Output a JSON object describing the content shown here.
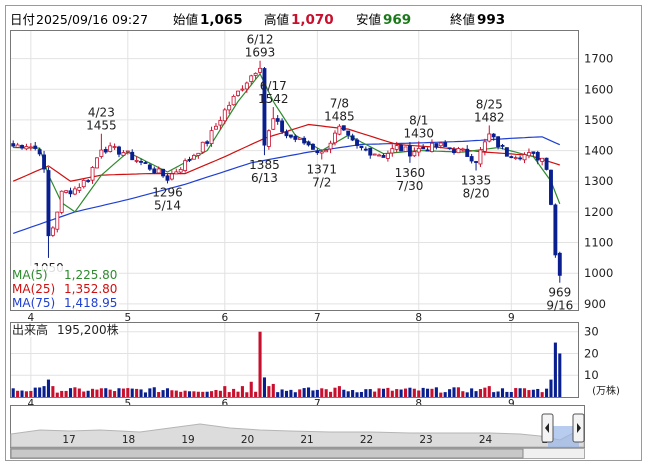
{
  "header": {
    "date_label": "日付",
    "datetime": "2025/09/16 09:27",
    "open_label": "始値",
    "open": "1,065",
    "high_label": "高値",
    "high": "1,070",
    "low_label": "安値",
    "low": "969",
    "close_label": "終値",
    "close": "993"
  },
  "colors": {
    "up": "#c8102e",
    "down": "#0a1f8f",
    "ma5": "#2e8b2e",
    "ma25": "#d01010",
    "ma75": "#1f3fd1",
    "high_value": "#c8102e",
    "low_value": "#1a7a1a"
  },
  "legend": {
    "ma5_label": "MA(5)",
    "ma5_value": "1,225.80",
    "ma25_label": "MA(25)",
    "ma25_value": "1,352.80",
    "ma75_label": "MA(75)",
    "ma75_value": "1,418.95"
  },
  "volume_header": {
    "label": "出来高",
    "value": "195,200株"
  },
  "volume_unit": "(万株)",
  "chart_data": [
    {
      "type": "candlestick",
      "title": "",
      "x_tick_labels": [
        "4",
        "5",
        "6",
        "7",
        "8",
        "9"
      ],
      "y_ticks": [
        900,
        1000,
        1100,
        1200,
        1300,
        1400,
        1500,
        1600,
        1700
      ],
      "ylim": [
        880,
        1790
      ],
      "grid": true,
      "x_start": "2025-03-26",
      "x_end": "2025-09-16",
      "x_tick_dates": [
        "2025-04-01",
        "2025-05-01",
        "2025-06-02",
        "2025-07-01",
        "2025-08-01",
        "2025-09-01"
      ],
      "anchors": [
        [
          "2025-03-26",
          1415
        ],
        [
          "2025-03-31",
          1420
        ],
        [
          "2025-04-03",
          1400
        ],
        [
          "2025-04-04",
          1330
        ],
        [
          "2025-04-07",
          1120
        ],
        [
          "2025-04-08",
          1150
        ],
        [
          "2025-04-10",
          1260
        ],
        [
          "2025-04-15",
          1275
        ],
        [
          "2025-04-18",
          1310
        ],
        [
          "2025-04-23",
          1410
        ],
        [
          "2025-04-30",
          1395
        ],
        [
          "2025-05-08",
          1345
        ],
        [
          "2025-05-14",
          1310
        ],
        [
          "2025-05-20",
          1360
        ],
        [
          "2025-05-27",
          1430
        ],
        [
          "2025-06-02",
          1530
        ],
        [
          "2025-06-06",
          1610
        ],
        [
          "2025-06-12",
          1680
        ],
        [
          "2025-06-13",
          1420
        ],
        [
          "2025-06-17",
          1500
        ],
        [
          "2025-06-20",
          1450
        ],
        [
          "2025-06-27",
          1420
        ],
        [
          "2025-07-02",
          1390
        ],
        [
          "2025-07-08",
          1470
        ],
        [
          "2025-07-14",
          1410
        ],
        [
          "2025-07-22",
          1385
        ],
        [
          "2025-07-25",
          1410
        ],
        [
          "2025-07-30",
          1395
        ],
        [
          "2025-08-01",
          1405
        ],
        [
          "2025-08-08",
          1415
        ],
        [
          "2025-08-15",
          1395
        ],
        [
          "2025-08-20",
          1370
        ],
        [
          "2025-08-25",
          1450
        ],
        [
          "2025-08-29",
          1390
        ],
        [
          "2025-09-05",
          1385
        ],
        [
          "2025-09-10",
          1375
        ],
        [
          "2025-09-11",
          1350
        ],
        [
          "2025-09-12",
          1230
        ],
        [
          "2025-09-15",
          1060
        ],
        [
          "2025-09-16",
          993
        ]
      ],
      "ma5": [
        [
          "2025-03-26",
          1410
        ],
        [
          "2025-04-03",
          1408
        ],
        [
          "2025-04-07",
          1320
        ],
        [
          "2025-04-10",
          1230
        ],
        [
          "2025-04-15",
          1200
        ],
        [
          "2025-04-23",
          1320
        ],
        [
          "2025-05-01",
          1395
        ],
        [
          "2025-05-14",
          1330
        ],
        [
          "2025-05-27",
          1400
        ],
        [
          "2025-06-05",
          1560
        ],
        [
          "2025-06-12",
          1650
        ],
        [
          "2025-06-17",
          1560
        ],
        [
          "2025-06-24",
          1450
        ],
        [
          "2025-07-02",
          1400
        ],
        [
          "2025-07-10",
          1450
        ],
        [
          "2025-07-22",
          1390
        ],
        [
          "2025-08-01",
          1400
        ],
        [
          "2025-08-15",
          1395
        ],
        [
          "2025-08-27",
          1410
        ],
        [
          "2025-09-08",
          1380
        ],
        [
          "2025-09-12",
          1300
        ],
        [
          "2025-09-16",
          1226
        ]
      ],
      "ma25": [
        [
          "2025-03-26",
          1300
        ],
        [
          "2025-04-07",
          1350
        ],
        [
          "2025-04-14",
          1300
        ],
        [
          "2025-04-23",
          1320
        ],
        [
          "2025-05-08",
          1325
        ],
        [
          "2025-05-20",
          1325
        ],
        [
          "2025-06-02",
          1380
        ],
        [
          "2025-06-13",
          1440
        ],
        [
          "2025-06-27",
          1485
        ],
        [
          "2025-07-10",
          1470
        ],
        [
          "2025-07-25",
          1420
        ],
        [
          "2025-08-08",
          1410
        ],
        [
          "2025-08-22",
          1395
        ],
        [
          "2025-09-05",
          1385
        ],
        [
          "2025-09-16",
          1353
        ]
      ],
      "ma75": [
        [
          "2025-03-26",
          1130
        ],
        [
          "2025-04-15",
          1200
        ],
        [
          "2025-05-01",
          1240
        ],
        [
          "2025-05-20",
          1290
        ],
        [
          "2025-06-10",
          1360
        ],
        [
          "2025-06-27",
          1395
        ],
        [
          "2025-07-15",
          1420
        ],
        [
          "2025-08-01",
          1425
        ],
        [
          "2025-08-15",
          1430
        ],
        [
          "2025-09-01",
          1440
        ],
        [
          "2025-09-10",
          1445
        ],
        [
          "2025-09-16",
          1419
        ]
      ],
      "annotations": [
        {
          "date": "2025-06-12",
          "price": 1693,
          "text_date": "6/12",
          "text_value": "1693",
          "pos": "above"
        },
        {
          "date": "2025-06-17",
          "price": 1542,
          "text_date": "6/17",
          "text_value": "1542",
          "pos": "above"
        },
        {
          "date": "2025-04-23",
          "price": 1455,
          "text_date": "4/23",
          "text_value": "1455",
          "pos": "above"
        },
        {
          "date": "2025-07-08",
          "price": 1485,
          "text_date": "7/8",
          "text_value": "1485",
          "pos": "above"
        },
        {
          "date": "2025-08-01",
          "price": 1430,
          "text_date": "8/1",
          "text_value": "1430",
          "pos": "above"
        },
        {
          "date": "2025-08-25",
          "price": 1482,
          "text_date": "8/25",
          "text_value": "1482",
          "pos": "above"
        },
        {
          "date": "2025-06-13",
          "price": 1385,
          "text_date": "6/13",
          "text_value": "1385",
          "pos": "below"
        },
        {
          "date": "2025-07-02",
          "price": 1371,
          "text_date": "7/2",
          "text_value": "1371",
          "pos": "below"
        },
        {
          "date": "2025-07-30",
          "price": 1360,
          "text_date": "7/30",
          "text_value": "1360",
          "pos": "below"
        },
        {
          "date": "2025-08-20",
          "price": 1335,
          "text_date": "8/20",
          "text_value": "1335",
          "pos": "below"
        },
        {
          "date": "2025-05-14",
          "price": 1296,
          "text_date": "5/14",
          "text_value": "1296",
          "pos": "below"
        },
        {
          "date": "2025-04-07",
          "price": 1050,
          "text_date": "",
          "text_value": "1050",
          "pos": "below"
        },
        {
          "date": "2025-09-16",
          "price": 969,
          "text_date": "9/16",
          "text_value": "969",
          "pos": "below"
        }
      ]
    },
    {
      "type": "bar",
      "title": "",
      "y_ticks": [
        10,
        20,
        30
      ],
      "ylim": [
        0,
        34
      ],
      "unit": "(万株)",
      "x_tick_labels": [
        "4",
        "5",
        "6",
        "7",
        "8",
        "9"
      ],
      "baseline": 2.0,
      "spikes": [
        [
          "2025-04-04",
          5
        ],
        [
          "2025-04-07",
          8
        ],
        [
          "2025-04-08",
          5
        ],
        [
          "2025-04-23",
          4
        ],
        [
          "2025-05-14",
          4
        ],
        [
          "2025-06-02",
          5
        ],
        [
          "2025-06-06",
          5
        ],
        [
          "2025-06-10",
          7
        ],
        [
          "2025-06-12",
          30
        ],
        [
          "2025-06-13",
          9
        ],
        [
          "2025-06-16",
          5
        ],
        [
          "2025-06-17",
          6
        ],
        [
          "2025-07-02",
          4
        ],
        [
          "2025-07-08",
          5
        ],
        [
          "2025-08-25",
          5
        ],
        [
          "2025-09-12",
          8
        ],
        [
          "2025-09-15",
          25
        ],
        [
          "2025-09-16",
          20
        ]
      ]
    }
  ],
  "navigator": {
    "labels": [
      "17",
      "18",
      "19",
      "20",
      "21",
      "22",
      "23",
      "24",
      "2"
    ]
  }
}
